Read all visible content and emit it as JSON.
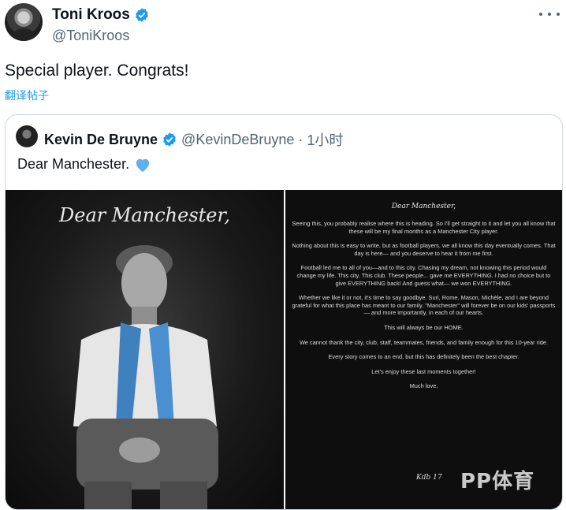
{
  "author": {
    "name": "Toni Kroos",
    "handle": "@ToniKroos"
  },
  "tweet": {
    "text": "Special player. Congrats!",
    "translate_label": "翻译帖子"
  },
  "quoted": {
    "name": "Kevin De Bruyne",
    "handle": "@KevinDeBruyne",
    "separator": "·",
    "time": "1小时",
    "text": "Dear Manchester.",
    "image_left_title": "Dear Manchester,",
    "letter": {
      "heading": "Dear Manchester,",
      "paragraphs": [
        "Seeing this, you probably realise where this is heading. So I'll get straight to it and let you all know that these will be my final months as a Manchester City player.",
        "Nothing about this is easy to write, but as football players, we all know this day eventually comes. That day is here— and you deserve to hear it from me first.",
        "Football led me to all of you—and to this city. Chasing my dream, not knowing this period would change my life. This city. This club. These people... gave me EVERYTHING. I had no choice but to give EVERYTHING back! And guess what— we won EVERYTHING.",
        "Whether we like it or not, it's time to say goodbye. Suri, Rome, Mason, Michèle, and I are beyond grateful for what this place has meant to our family. \"Manchester\" will forever be on our kids' passports— and more importantly, in each of our hearts.",
        "This will always be our HOME.",
        "We cannot thank the city, club, staff, teammates, friends, and family enough for this 10-year ride.",
        "Every story comes to an end, but this has definitely been the best chapter.",
        "Let's enjoy these last moments together!",
        "Much love,"
      ],
      "signature": "Kdb 17"
    }
  },
  "watermark": "PP体育",
  "colors": {
    "link": "#1d9bf0",
    "verified": "#1d9bf0",
    "heart": "#5db1ef"
  },
  "icons": [
    "verified-badge-icon",
    "more-options-icon",
    "blue-heart-icon"
  ]
}
